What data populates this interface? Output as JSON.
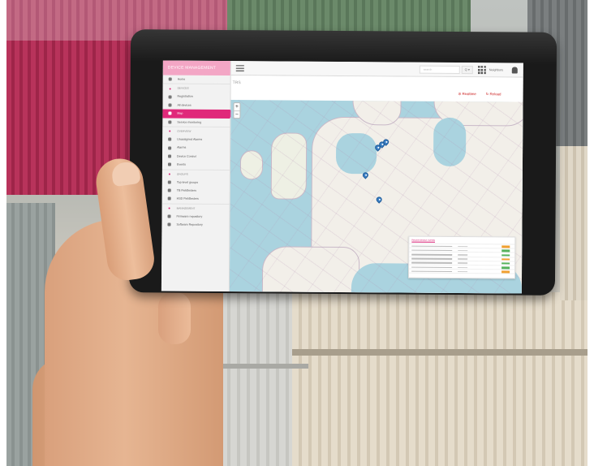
{
  "scene": {
    "background_colors": {
      "pink_container": "#b8335b",
      "beige_container": "#e5dccb",
      "tablet_frame": "#1a1a1a"
    }
  },
  "app": {
    "brand": "DEVICE MANAGEMENT",
    "accent": "#e0287a",
    "sidebar": {
      "home": "Home",
      "section_devices": "DEVICES",
      "registration": "Registration",
      "all_devices": "All devices",
      "map": "Map",
      "service_monitoring": "Service monitoring",
      "section_overview": "OVERVIEW",
      "unassigned_alarms": "Unassigned Alarms",
      "alarms": "Alarms",
      "device_control": "Device Control",
      "events": "Events",
      "section_groups": "GROUPS",
      "top_level_groups": "Top level groups",
      "tb_fieldtesters": "TB Fieldtesters",
      "hsd_fieldtesters": "HSD Fieldtesters",
      "section_management": "MANAGEMENT",
      "firmware_repository": "Firmware repository",
      "software_repository": "Software Repository"
    },
    "topbar": {
      "search_placeholder": "search",
      "search_button": "Q ▾",
      "user": "Neighbors"
    },
    "page": {
      "title_fragment": "TRS",
      "realtime": "Realtime",
      "reload": "Reload",
      "zoom_in": "+",
      "zoom_out": "−"
    },
    "map": {
      "markers": 5,
      "panel_title": "Recent device events"
    }
  }
}
